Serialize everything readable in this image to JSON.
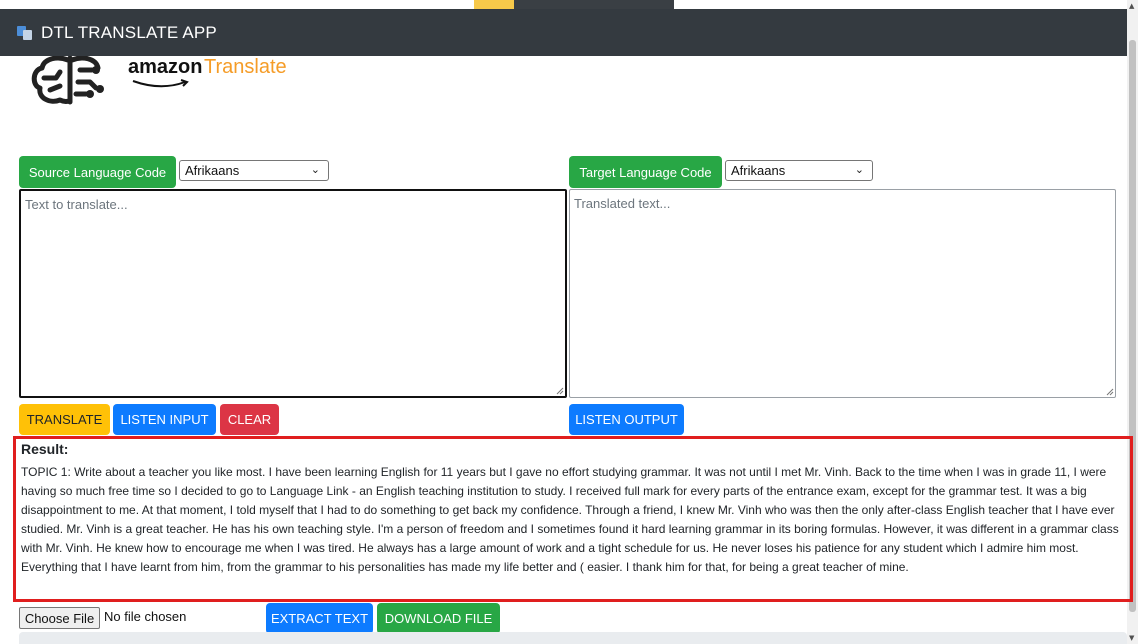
{
  "app": {
    "title": "DTL TRANSLATE APP"
  },
  "logo": {
    "brand": "amazon",
    "product": "Translate"
  },
  "source": {
    "label": "Source Language Code",
    "selected_language": "Afrikaans",
    "placeholder": "Text to translate..."
  },
  "target": {
    "label": "Target Language Code",
    "selected_language": "Afrikaans",
    "placeholder": "Translated text..."
  },
  "actions": {
    "translate": "TRANSLATE",
    "listen_input": "LISTEN INPUT",
    "clear": "CLEAR",
    "listen_output": "LISTEN OUTPUT",
    "extract_text": "EXTRACT TEXT",
    "download_file": "DOWNLOAD FILE"
  },
  "result": {
    "title": "Result:",
    "text": "TOPIC 1: Write about a teacher you like most. I have been learning English for 11 years but I gave no effort studying grammar. It was not until I met Mr. Vinh. Back to the time when I was in grade 11, I were having so much free time so I decided to go to Language Link - an English teaching institution to study. I received full mark for every parts of the entrance exam, except for the grammar test. It was a big disappointment to me. At that moment, I told myself that I had to do something to get back my confidence. Through a friend, I knew Mr. Vinh who was then the only after-class English teacher that I have ever studied. Mr. Vinh is a great teacher. He has his own teaching style. I'm a person of freedom and I sometimes found it hard learning grammar in its boring formulas. However, it was different in a grammar class with Mr. Vinh. He knew how to encourage me when I was tired. He always has a large amount of work and a tight schedule for us. He never loses his patience for any student which I admire him most. Everything that I have learnt from him, from the grammar to his personalities has made my life better and ( easier. I thank him for that, for being a great teacher of mine."
  },
  "file": {
    "button_label": "Choose File",
    "status": "No file chosen"
  },
  "colors": {
    "navbar": "#343a40",
    "green": "#28a745",
    "blue": "#0d7bff",
    "red": "#dc3545",
    "yellow": "#ffc107",
    "highlight_border": "#e01e1e",
    "amazon_orange": "#f59c27"
  },
  "icons": {
    "app_icon": "translate-app-icon",
    "logo_icon": "brain-circuit-icon",
    "select_arrow": "chevron-down-icon",
    "resize_grip": "resize-grip-icon"
  }
}
